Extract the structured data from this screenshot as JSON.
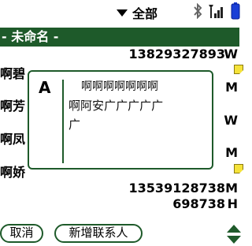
{
  "status": {
    "category_label": "全部"
  },
  "section": {
    "header": "- 未命名 -"
  },
  "contacts": [
    {
      "name": "",
      "number": "13829327893",
      "type": "W"
    },
    {
      "name": "啊碧",
      "number": "",
      "type": "M"
    },
    {
      "name": "啊芳",
      "number": "",
      "type": "W"
    },
    {
      "name": "啊凤",
      "number": "",
      "type": "M"
    },
    {
      "name": "啊娇",
      "number": "",
      "type": ""
    },
    {
      "name": "",
      "number": "13539128738",
      "type": "M"
    },
    {
      "name": "",
      "number": "698738",
      "type": "H"
    }
  ],
  "popup": {
    "letter": "A",
    "candidates_row1": [
      "啊",
      "啊",
      "啊",
      "啊",
      "啊",
      "啊",
      "啊"
    ],
    "candidates_row2": [
      "啊",
      "阿",
      "安",
      "广",
      "广",
      "广",
      "广",
      "广"
    ],
    "candidates_row3": [
      "广"
    ]
  },
  "bottom": {
    "cancel_label": "取消",
    "new_contact_label": "新增联系人"
  },
  "colors": {
    "accent": "#1e5a2a",
    "note": "#f5e33a"
  },
  "icons": [
    "chevron-down-icon",
    "bluetooth-icon",
    "signal-icon",
    "battery-icon",
    "note-icon",
    "scroll-arrows-icon"
  ]
}
